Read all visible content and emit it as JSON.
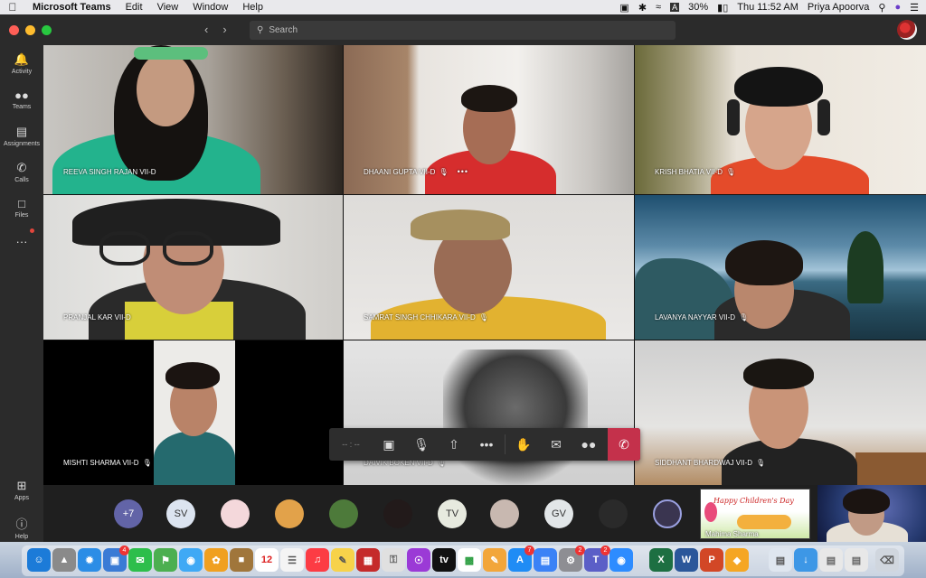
{
  "menubar": {
    "app_name": "Microsoft Teams",
    "menus": [
      "Edit",
      "View",
      "Window",
      "Help"
    ],
    "battery": "30%",
    "clock": "Thu 11:52 AM",
    "user": "Priya Apoorva"
  },
  "titlebar": {
    "search_placeholder": "Search"
  },
  "rail": {
    "items": [
      {
        "label": "Activity",
        "icon": "bell-icon"
      },
      {
        "label": "Teams",
        "icon": "teams-icon"
      },
      {
        "label": "Assignments",
        "icon": "assignments-icon"
      },
      {
        "label": "Calls",
        "icon": "phone-icon"
      },
      {
        "label": "Files",
        "icon": "file-icon"
      },
      {
        "label": "",
        "icon": "more-icon"
      },
      {
        "label": "Apps",
        "icon": "apps-icon"
      },
      {
        "label": "Help",
        "icon": "help-icon"
      }
    ]
  },
  "participants": [
    {
      "name": "REEVA SINGH RAJAN VII-D"
    },
    {
      "name": "DHAANI GUPTA VII-D"
    },
    {
      "name": "KRISH BHATIA VII-D"
    },
    {
      "name": "PRANJAL KAR VII-D"
    },
    {
      "name": "SAMRAT SINGH CHHIKARA VII-D"
    },
    {
      "name": "LAVANYA NAYYAR VII-D"
    },
    {
      "name": "MISHTI SHARMA VII-D"
    },
    {
      "name": "DAIVIK BOKEN VII-D"
    },
    {
      "name": "SIDDHANT BHARDWAJ VII-D"
    }
  ],
  "controls": {
    "timer": "-- : --"
  },
  "strip": {
    "overflow_count": "+7",
    "avatars": [
      "SV",
      "TV",
      "GV"
    ],
    "shared_title": "Happy Children's Day",
    "shared_by": "Mahima Sharma"
  },
  "dock": {
    "badges": {
      "app_store": "7",
      "teams": "2",
      "photos": "4",
      "system": "2"
    }
  }
}
